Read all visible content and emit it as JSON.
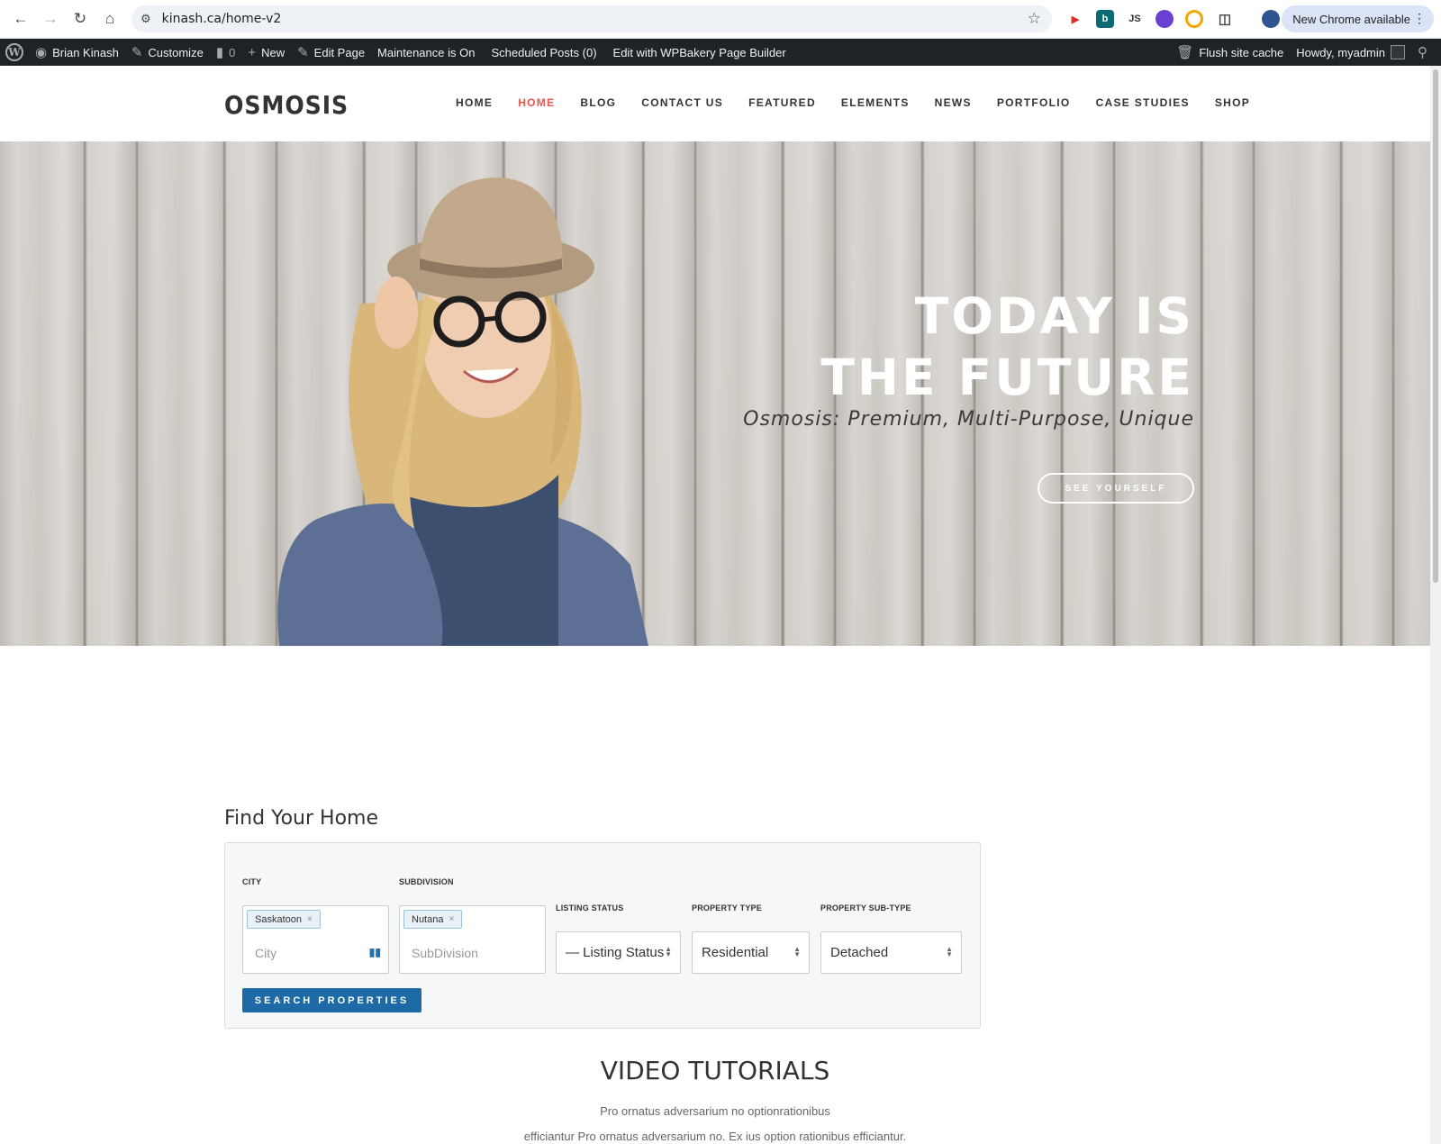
{
  "browser": {
    "url": "kinash.ca/home-v2",
    "update_label": "New Chrome available",
    "ext_js_label": "JS"
  },
  "adminbar": {
    "user": "Brian Kinash",
    "customize": "Customize",
    "comments_count": "0",
    "new": "New",
    "edit_page": "Edit Page",
    "maintenance": "Maintenance is On",
    "scheduled": "Scheduled Posts (0)",
    "wpbakery": "Edit with WPBakery Page Builder",
    "flush": "Flush site cache",
    "howdy": "Howdy, myadmin"
  },
  "site": {
    "logo": "osmosis",
    "menu": [
      "HOME",
      "HOME",
      "BLOG",
      "CONTACT US",
      "FEATURED",
      "ELEMENTS",
      "NEWS",
      "PORTFOLIO",
      "CASE STUDIES",
      "SHOP"
    ],
    "active_menu_index": 1
  },
  "hero": {
    "title_line1": "TODAY IS",
    "title_line2": "THE FUTURE",
    "subtitle": "Osmosis: Premium, Multi-Purpose, Unique",
    "button": "SEE YOURSELF"
  },
  "search": {
    "title": "Find Your Home",
    "city_label": "CITY",
    "city_tag": "Saskatoon",
    "city_placeholder": "City",
    "subdivision_label": "SUBDIVISION",
    "subdivision_tag": "Nutana",
    "subdivision_placeholder": "SubDivision",
    "status_label": "LISTING STATUS",
    "status_value": "— Listing Status",
    "ptype_label": "PROPERTY TYPE",
    "ptype_value": "Residential",
    "psub_label": "PROPERTY SUB-TYPE",
    "psub_value": "Detached",
    "button": "SEARCH PROPERTIES"
  },
  "video": {
    "title": "VIDEO TUTORIALS",
    "p1": "Pro ornatus adversarium no optionrationibus",
    "p2": "efficiantur Pro ornatus adversarium no. Ex ius option rationibus efficiantur."
  },
  "colors": {
    "accent": "#e8574d",
    "button_blue": "#1d6aa5",
    "adminbar_bg": "#1d2327"
  }
}
